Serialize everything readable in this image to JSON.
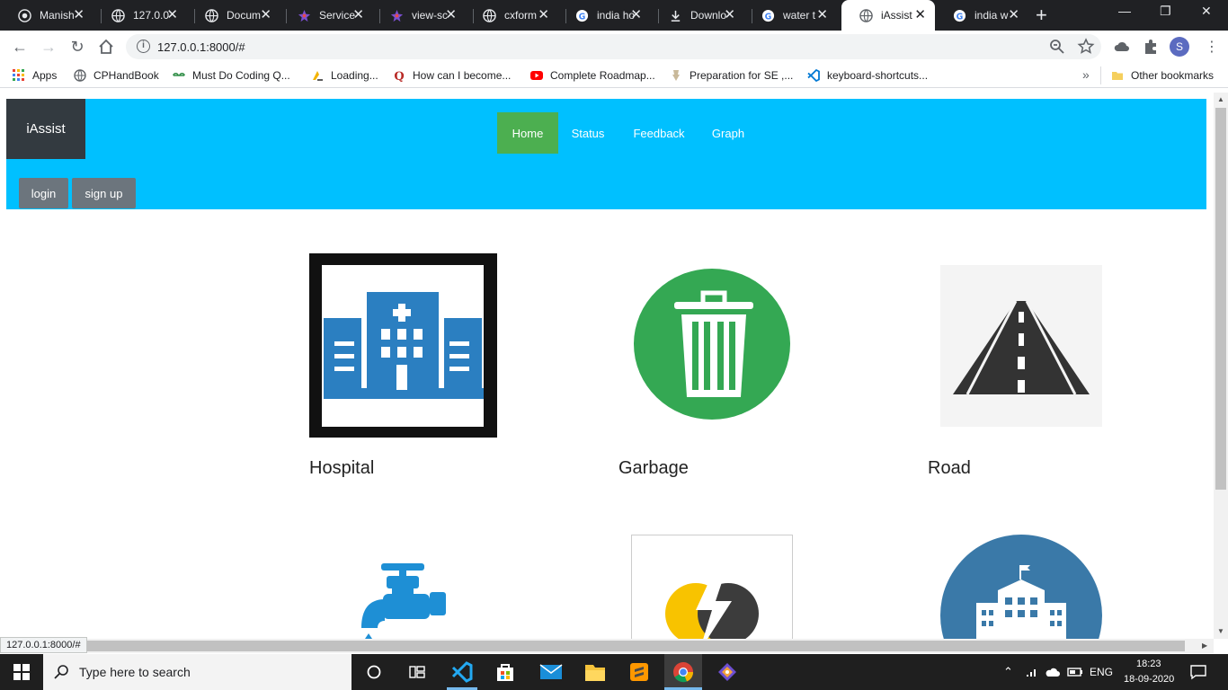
{
  "browser": {
    "tabs": [
      {
        "title": "Manish",
        "icon": "github-icon"
      },
      {
        "title": "127.0.0",
        "icon": "globe-icon"
      },
      {
        "title": "Docum",
        "icon": "globe-icon"
      },
      {
        "title": "Service",
        "icon": "star-icon"
      },
      {
        "title": "view-sc",
        "icon": "star-icon"
      },
      {
        "title": "cxform",
        "icon": "globe-icon"
      },
      {
        "title": "india ho",
        "icon": "google-icon"
      },
      {
        "title": "Downlo",
        "icon": "download-icon"
      },
      {
        "title": "water t",
        "icon": "google-icon"
      },
      {
        "title": "iAssist",
        "icon": "globe-icon",
        "active": true
      },
      {
        "title": "india w",
        "icon": "google-icon"
      }
    ],
    "new_tab": "+",
    "url": "127.0.0.1:8000/#",
    "profile_initial": "S",
    "bookmarks": [
      {
        "label": "Apps",
        "icon": "apps-grid-icon"
      },
      {
        "label": "CPHandBook",
        "icon": "globe-icon"
      },
      {
        "label": "Must Do Coding Q...",
        "icon": "gfg-icon"
      },
      {
        "label": "Loading...",
        "icon": "loading-icon"
      },
      {
        "label": "How can I become...",
        "icon": "quora-icon"
      },
      {
        "label": "Complete Roadmap...",
        "icon": "youtube-icon"
      },
      {
        "label": "Preparation for SE ,...",
        "icon": "bookmark-image-icon"
      },
      {
        "label": "keyboard-shortcuts...",
        "icon": "vscode-icon"
      }
    ],
    "bookmarks_overflow": "»",
    "other_bookmarks": "Other bookmarks",
    "status_url": "127.0.0.1:8000/#"
  },
  "site": {
    "brand": "iAssist",
    "nav": [
      {
        "label": "Home",
        "active": true
      },
      {
        "label": "Status"
      },
      {
        "label": "Feedback"
      },
      {
        "label": "Graph"
      }
    ],
    "auth": {
      "login": "login",
      "signup": "sign up"
    },
    "categories": [
      {
        "label": "Hospital",
        "icon": "hospital-icon"
      },
      {
        "label": "Garbage",
        "icon": "trash-can-icon"
      },
      {
        "label": "Road",
        "icon": "road-icon"
      },
      {
        "label": "",
        "icon": "water-tap-icon"
      },
      {
        "label": "",
        "icon": "electricity-icon"
      },
      {
        "label": "",
        "icon": "municipal-building-icon"
      }
    ],
    "colors": {
      "navbar": "#00c0ff",
      "active_nav": "#4caf50",
      "brand_bg": "#333a40",
      "auth_btn": "#6c757d"
    }
  },
  "taskbar": {
    "search_placeholder": "Type here to search",
    "language": "ENG",
    "time": "18:23",
    "date": "18-09-2020"
  }
}
